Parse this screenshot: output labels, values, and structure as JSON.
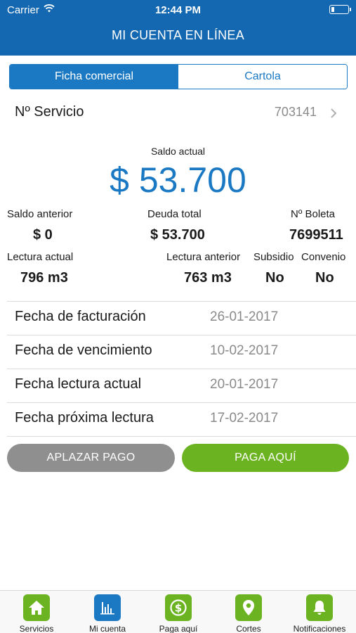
{
  "status_bar": {
    "carrier": "Carrier",
    "time": "12:44 PM"
  },
  "nav": {
    "title": "MI CUENTA EN LÍNEA"
  },
  "segments": {
    "left": "Ficha comercial",
    "right": "Cartola"
  },
  "servicio": {
    "label": "Nº Servicio",
    "value": "703141"
  },
  "saldo": {
    "label": "Saldo actual",
    "amount": "$ 53.700"
  },
  "summary": {
    "saldo_anterior_label": "Saldo anterior",
    "saldo_anterior_value": "$ 0",
    "deuda_total_label": "Deuda total",
    "deuda_total_value": "$ 53.700",
    "boleta_label": "Nº Boleta",
    "boleta_value": "7699511",
    "lectura_actual_label": "Lectura actual",
    "lectura_actual_value": "796 m3",
    "lectura_anterior_label": "Lectura anterior",
    "lectura_anterior_value": "763 m3",
    "subsidio_label": "Subsidio",
    "subsidio_value": "No",
    "convenio_label": "Convenio",
    "convenio_value": "No"
  },
  "dates": [
    {
      "label": "Fecha de facturación",
      "value": "26-01-2017"
    },
    {
      "label": "Fecha de vencimiento",
      "value": "10-02-2017"
    },
    {
      "label": "Fecha lectura actual",
      "value": "20-01-2017"
    },
    {
      "label": "Fecha próxima lectura",
      "value": "17-02-2017"
    }
  ],
  "buttons": {
    "aplazar": "APLAZAR PAGO",
    "paga": "PAGA AQUÍ"
  },
  "tabs": [
    {
      "label": "Servicios",
      "icon": "home-icon"
    },
    {
      "label": "Mi cuenta",
      "icon": "bar-chart-icon"
    },
    {
      "label": "Paga aquí",
      "icon": "dollar-icon"
    },
    {
      "label": "Cortes",
      "icon": "map-pin-icon"
    },
    {
      "label": "Notificaciones",
      "icon": "bell-icon"
    }
  ],
  "colors": {
    "primary_blue": "#1468b1",
    "accent_blue": "#1b79c4",
    "green": "#6bb321",
    "gray_button": "#8f8f8f"
  }
}
